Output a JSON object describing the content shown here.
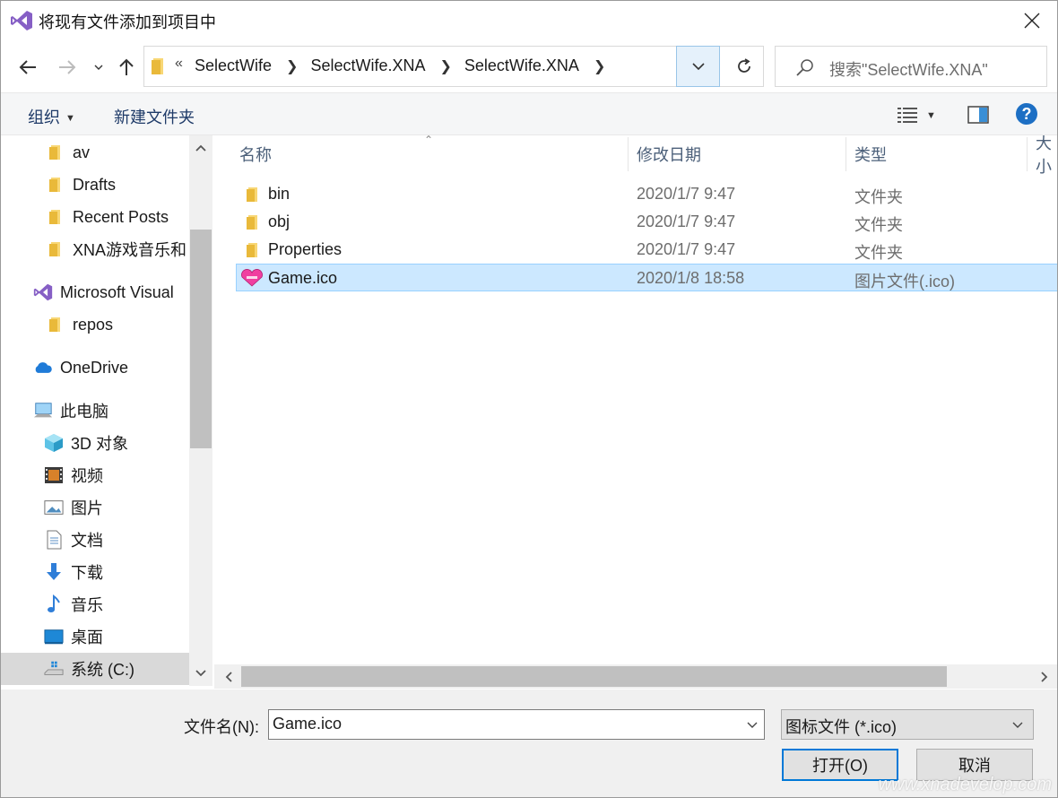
{
  "window": {
    "title": "将现有文件添加到项目中"
  },
  "nav": {
    "breadcrumbs": [
      "SelectWife",
      "SelectWife.XNA",
      "SelectWife.XNA"
    ],
    "overflow": "«",
    "search_placeholder": "搜索\"SelectWife.XNA\""
  },
  "toolbar": {
    "organize_label": "组织",
    "new_folder_label": "新建文件夹"
  },
  "sidebar": {
    "items": [
      {
        "label": "av",
        "icon": "folder-icon"
      },
      {
        "label": "Drafts",
        "icon": "folder-icon"
      },
      {
        "label": "Recent Posts",
        "icon": "folder-icon"
      },
      {
        "label": "XNA游戏音乐和",
        "icon": "folder-icon"
      },
      {
        "label": "Microsoft Visual",
        "icon": "visual-studio-icon"
      },
      {
        "label": "repos",
        "icon": "folder-icon"
      },
      {
        "label": "OneDrive",
        "icon": "onedrive-icon"
      },
      {
        "label": "此电脑",
        "icon": "this-pc-icon"
      },
      {
        "label": "3D 对象",
        "icon": "3d-objects-icon"
      },
      {
        "label": "视频",
        "icon": "videos-icon"
      },
      {
        "label": "图片",
        "icon": "pictures-icon"
      },
      {
        "label": "文档",
        "icon": "documents-icon"
      },
      {
        "label": "下载",
        "icon": "downloads-icon"
      },
      {
        "label": "音乐",
        "icon": "music-icon"
      },
      {
        "label": "桌面",
        "icon": "desktop-icon"
      },
      {
        "label": "系统 (C:)",
        "icon": "drive-icon"
      }
    ],
    "selected": "系统 (C:)"
  },
  "files": {
    "columns": [
      "名称",
      "修改日期",
      "类型",
      "大小"
    ],
    "rows": [
      {
        "name": "bin",
        "date": "2020/1/7 9:47",
        "type": "文件夹",
        "icon": "folder-icon"
      },
      {
        "name": "obj",
        "date": "2020/1/7 9:47",
        "type": "文件夹",
        "icon": "folder-icon"
      },
      {
        "name": "Properties",
        "date": "2020/1/7 9:47",
        "type": "文件夹",
        "icon": "folder-icon"
      },
      {
        "name": "Game.ico",
        "date": "2020/1/8 18:58",
        "type": "图片文件(.ico)",
        "icon": "heart-ico-icon"
      }
    ],
    "selected": "Game.ico"
  },
  "footer": {
    "filename_label": "文件名(N):",
    "filename_value": "Game.ico",
    "filetype_value": "图标文件 (*.ico)",
    "open_label": "打开(O)",
    "cancel_label": "取消",
    "watermark": "www.xnadevelop.com"
  },
  "colors": {
    "accent": "#0078d7",
    "selection": "#cce8ff",
    "selection_border": "#99d1ff"
  }
}
